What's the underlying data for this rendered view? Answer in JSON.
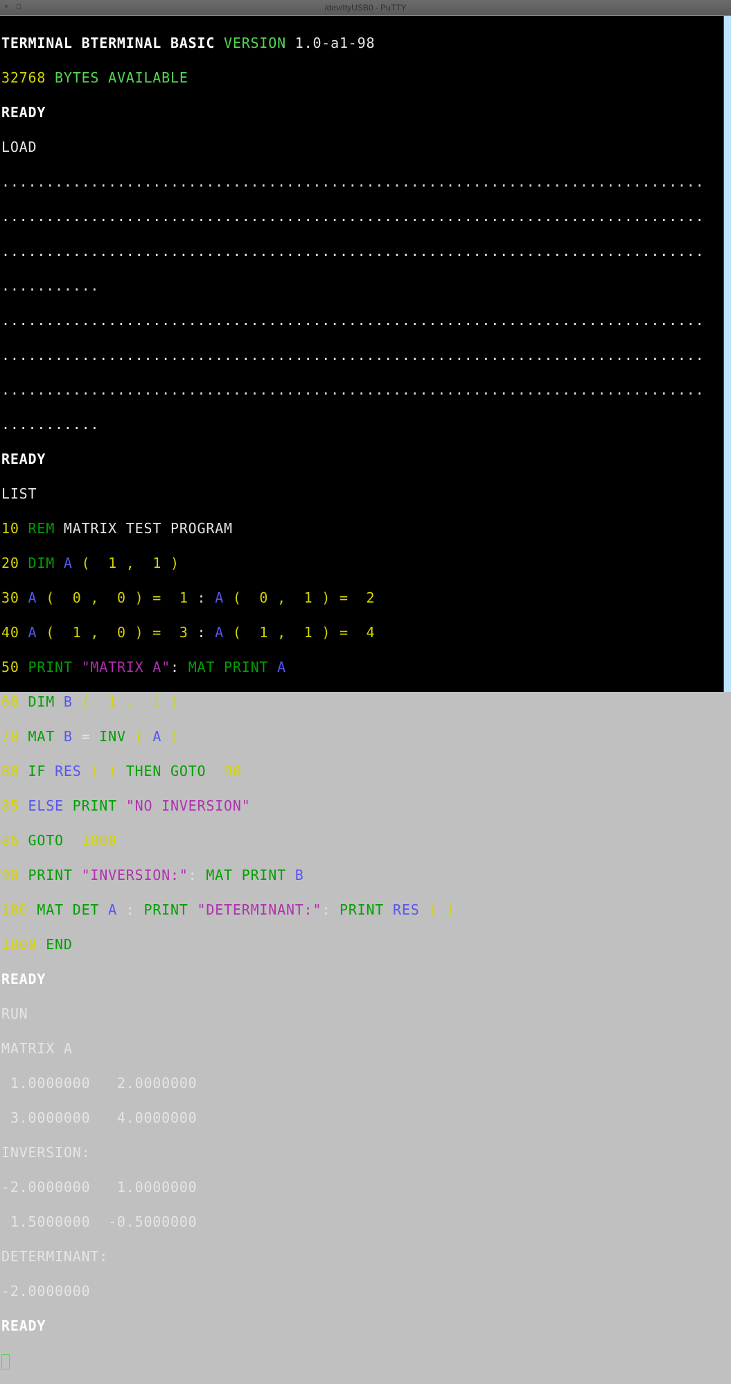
{
  "window": {
    "title": "/dev/ttyUSB0 - PuTTY",
    "btn_close": "×",
    "btn_max": "□",
    "btn_min": "_"
  },
  "header": {
    "name1": "TERMINAL BTERMINAL BASIC",
    "version_word": " VERSION ",
    "version": "1.0-a1-98",
    "bytes_num": "32768",
    "bytes_txt": " BYTES AVAILABLE",
    "ready": "READY",
    "load": "LOAD"
  },
  "dots": {
    "long": "...............................................................................",
    "short": "..........."
  },
  "prompts": {
    "ready2": "READY",
    "list": "LIST",
    "ready3": "READY",
    "run": "RUN",
    "ready4": "READY"
  },
  "program": {
    "l10_n": "10 ",
    "l10_k": "REM ",
    "l10_t": "MATRIX TEST PROGRAM",
    "l20_n": "20 ",
    "l20_k": "DIM ",
    "l20_v": "A",
    "l20_r": " (  1 ,  1 )",
    "l30_n": "30 ",
    "l30_v1": "A",
    "l30_a": " (  0 ,  0 ) = ",
    "l30_n1": " 1 ",
    "l30_c": ": ",
    "l30_v2": "A",
    "l30_b": " (  0 ,  1 ) = ",
    "l30_n2": " 2",
    "l40_n": "40 ",
    "l40_v1": "A",
    "l40_a": " (  1 ,  0 ) = ",
    "l40_n1": " 3 ",
    "l40_c": ": ",
    "l40_v2": "A",
    "l40_b": " (  1 ,  1 ) = ",
    "l40_n2": " 4",
    "l50_n": "50 ",
    "l50_k1": "PRINT ",
    "l50_s": "\"MATRIX A\"",
    "l50_c": ": ",
    "l50_k2": "MAT PRINT ",
    "l50_v": "A",
    "l60_n": "60 ",
    "l60_k": "DIM ",
    "l60_v": "B",
    "l60_r": " (  1 ,  1 )",
    "l70_n": "70 ",
    "l70_k": "MAT ",
    "l70_v1": "B",
    "l70_eq": " = ",
    "l70_inv": "INV",
    "l70_op": " ( ",
    "l70_v2": "A",
    "l70_cp": " )",
    "l80_n": "80 ",
    "l80_k": "IF ",
    "l80_v": "RES",
    "l80_r": " ( ) ",
    "l80_then": "THEN GOTO ",
    "l80_target": " 90",
    "l85_n": "85 ",
    "l85_else": "ELSE",
    "l85_sp": " ",
    "l85_k": "PRINT ",
    "l85_s": "\"NO INVERSION\"",
    "l86_n": "86 ",
    "l86_k": "GOTO ",
    "l86_t": " 1000",
    "l90_n": "90 ",
    "l90_k1": "PRINT ",
    "l90_s": "\"INVERSION:\"",
    "l90_c": ": ",
    "l90_k2": "MAT PRINT ",
    "l90_v": "B",
    "l100_n": "100 ",
    "l100_k1": "MAT DET ",
    "l100_v": "A",
    "l100_sp": " : ",
    "l100_k2": "PRINT ",
    "l100_s": "\"DETERMINANT:\"",
    "l100_c2": ": ",
    "l100_k3": "PRINT ",
    "l100_rv": "RES",
    "l100_p": " ( )",
    "l1000_n": "1000 ",
    "l1000_k": "END"
  },
  "output": {
    "mA": "MATRIX A",
    "r1": " 1.0000000   2.0000000",
    "r2": " 3.0000000   4.0000000",
    "inv": "INVERSION:",
    "r3": "-2.0000000   1.0000000",
    "r4": " 1.5000000  -0.5000000",
    "det": "DETERMINANT:",
    "dv": "-2.0000000"
  }
}
